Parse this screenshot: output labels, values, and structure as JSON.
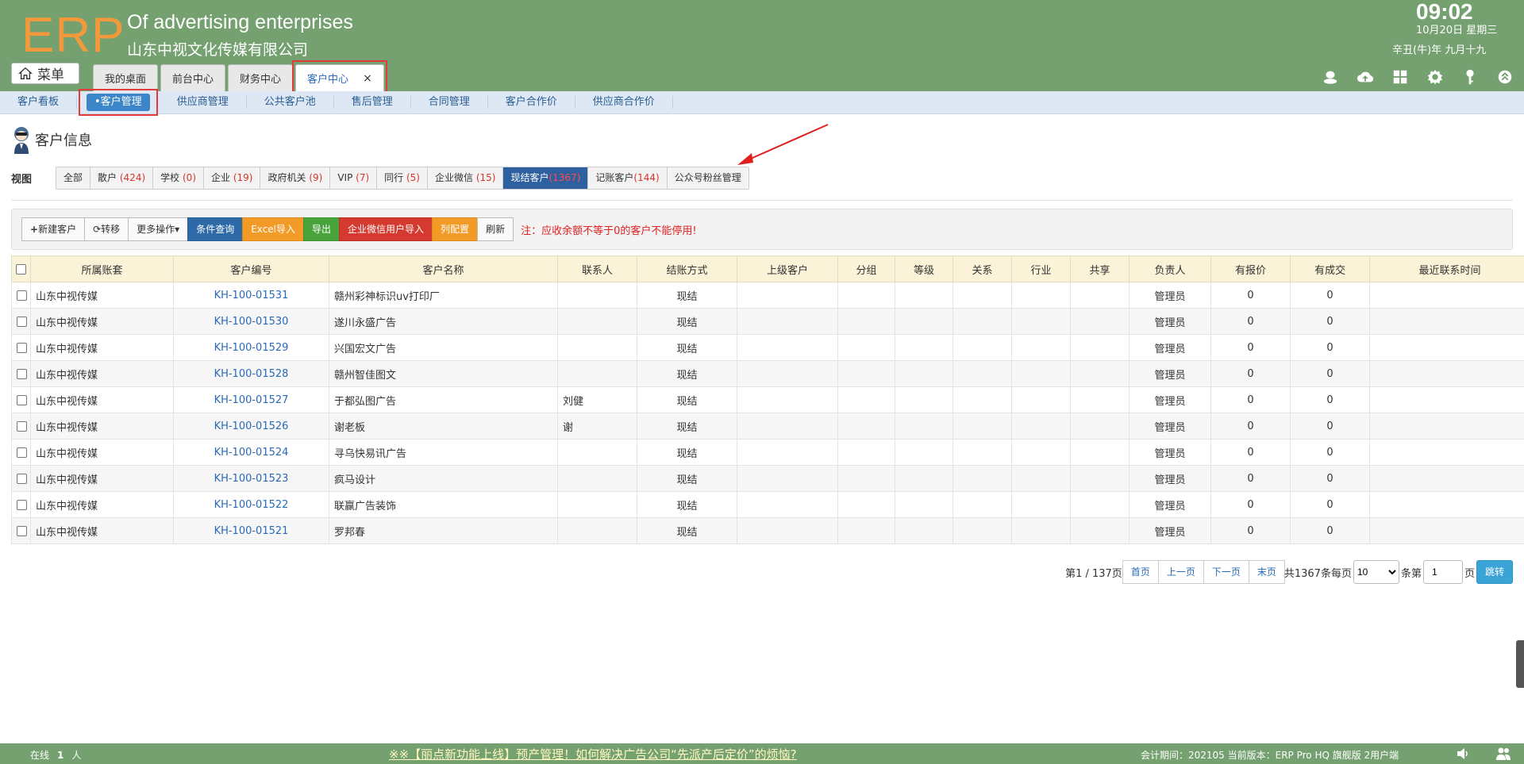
{
  "header": {
    "logo": "ERP",
    "brand_en": "Of advertising enterprises",
    "brand_cn": "山东中视文化传媒有限公司",
    "time": "09:02",
    "date": "10月20日 星期三",
    "lunar": "辛丑(牛)年 九月十九",
    "menu_label": "菜单",
    "tabs": [
      {
        "label": "我的桌面"
      },
      {
        "label": "前台中心"
      },
      {
        "label": "财务中心"
      },
      {
        "label": "客户中心",
        "close": "×"
      }
    ]
  },
  "subnav": {
    "items": [
      "客户看板",
      "•客户管理",
      "供应商管理",
      "公共客户池",
      "售后管理",
      "合同管理",
      "客户合作价",
      "供应商合作价"
    ]
  },
  "page": {
    "title": "客户信息",
    "views_label": "视图",
    "views": [
      {
        "label": "全部",
        "count": ""
      },
      {
        "label": "散户",
        "count": "(424)"
      },
      {
        "label": "学校",
        "count": "(0)"
      },
      {
        "label": "企业",
        "count": "(19)"
      },
      {
        "label": "政府机关",
        "count": "(9)"
      },
      {
        "label": "VIP",
        "count": "(7)"
      },
      {
        "label": "同行",
        "count": "(5)"
      },
      {
        "label": "企业微信",
        "count": "(15)"
      },
      {
        "label": "现结客户",
        "count": "(1367)"
      },
      {
        "label": "记账客户",
        "count": "(144)"
      },
      {
        "label": "公众号粉丝管理",
        "count": ""
      }
    ]
  },
  "toolbar": {
    "new": "新建客户",
    "transfer": "转移",
    "more": "更多操作",
    "query": "条件查询",
    "excel_import": "Excel导入",
    "export": "导出",
    "wecom_import": "企业微信用户导入",
    "columns": "列配置",
    "refresh": "刷新",
    "note": "注：应收余额不等于0的客户不能停用!"
  },
  "table": {
    "headers": [
      "所属账套",
      "客户编号",
      "客户名称",
      "联系人",
      "结账方式",
      "上级客户",
      "分组",
      "等级",
      "关系",
      "行业",
      "共享",
      "负责人",
      "有报价",
      "有成交",
      "最近联系时间"
    ],
    "rows": [
      [
        "山东中视传媒",
        "KH-100-01531",
        "赣州彩神标识uv打印厂",
        "",
        "现结",
        "",
        "",
        "",
        "",
        "",
        "",
        "管理员",
        "0",
        "0",
        ""
      ],
      [
        "山东中视传媒",
        "KH-100-01530",
        "遂川永盛广告",
        "",
        "现结",
        "",
        "",
        "",
        "",
        "",
        "",
        "管理员",
        "0",
        "0",
        ""
      ],
      [
        "山东中视传媒",
        "KH-100-01529",
        "兴国宏文广告",
        "",
        "现结",
        "",
        "",
        "",
        "",
        "",
        "",
        "管理员",
        "0",
        "0",
        ""
      ],
      [
        "山东中视传媒",
        "KH-100-01528",
        "赣州智佳图文",
        "",
        "现结",
        "",
        "",
        "",
        "",
        "",
        "",
        "管理员",
        "0",
        "0",
        ""
      ],
      [
        "山东中视传媒",
        "KH-100-01527",
        "于都弘图广告",
        "刘健",
        "现结",
        "",
        "",
        "",
        "",
        "",
        "",
        "管理员",
        "0",
        "0",
        ""
      ],
      [
        "山东中视传媒",
        "KH-100-01526",
        "谢老板",
        "谢",
        "现结",
        "",
        "",
        "",
        "",
        "",
        "",
        "管理员",
        "0",
        "0",
        ""
      ],
      [
        "山东中视传媒",
        "KH-100-01524",
        "寻乌快易讯广告",
        "",
        "现结",
        "",
        "",
        "",
        "",
        "",
        "",
        "管理员",
        "0",
        "0",
        ""
      ],
      [
        "山东中视传媒",
        "KH-100-01523",
        "疯马设计",
        "",
        "现结",
        "",
        "",
        "",
        "",
        "",
        "",
        "管理员",
        "0",
        "0",
        ""
      ],
      [
        "山东中视传媒",
        "KH-100-01522",
        "联赢广告装饰",
        "",
        "现结",
        "",
        "",
        "",
        "",
        "",
        "",
        "管理员",
        "0",
        "0",
        ""
      ],
      [
        "山东中视传媒",
        "KH-100-01521",
        "罗邦春",
        "",
        "现结",
        "",
        "",
        "",
        "",
        "",
        "",
        "管理员",
        "0",
        "0",
        ""
      ]
    ]
  },
  "pager": {
    "page_info": "第1 / 137页",
    "first": "首页",
    "prev": "上一页",
    "next": "下一页",
    "last": "末页",
    "total": "共1367条每页",
    "per_page": "10",
    "per_page_unit": "条第",
    "page_value": "1",
    "page_unit": "页",
    "go": "跳转"
  },
  "footer": {
    "online_label": "在线",
    "online_count": "1",
    "online_unit": "人",
    "news": "※※【丽点新功能上线】预产管理！如何解决广告公司“先派产后定价”的烦恼?",
    "version": "会计期间：202105 当前版本：ERP Pro HQ 旗舰版 2用户端"
  }
}
